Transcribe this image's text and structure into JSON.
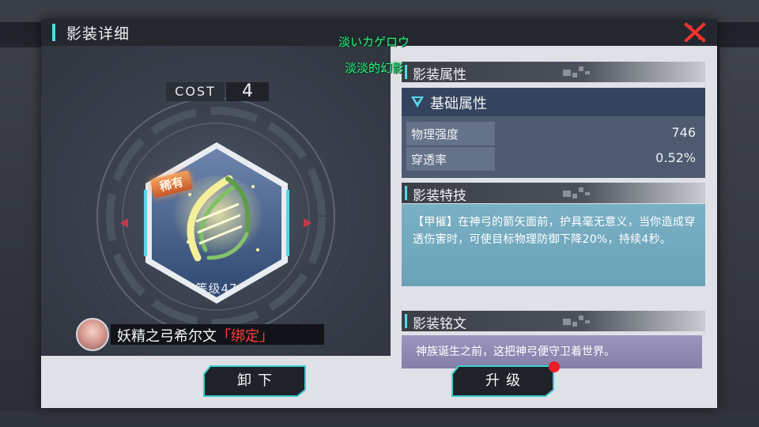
{
  "window": {
    "title": "影装详细"
  },
  "floating": {
    "line1": "淡いカゲロウ",
    "line2": "淡淡的幻影"
  },
  "equipment": {
    "cost_label": "COST",
    "cost_value": "4",
    "rarity": "稀有",
    "level": "等级47",
    "owner_name": "妖精之弓希尔文",
    "owner_bound": "「绑定」"
  },
  "sections": {
    "attributes_header": "影装属性",
    "base_attributes_title": "基础属性",
    "skill_header": "影装特技",
    "inscription_header": "影装铭文"
  },
  "attributes": [
    {
      "name": "物理强度",
      "value": "746"
    },
    {
      "name": "穿透率",
      "value": "0.52%"
    }
  ],
  "skill_text": "【甲摧】在神弓的箭矢面前，护具毫无意义，当你造成穿透伤害时，可使目标物理防御下降20%，持续4秒。",
  "inscription_text": "神族诞生之前，这把神弓便守卫着世界。",
  "buttons": {
    "unequip": "卸下",
    "upgrade": "升级"
  },
  "colors": {
    "accent": "#56d7e6",
    "close": "#f0352e",
    "notify": "#ee1c24",
    "floating_text": "#2cec84"
  }
}
